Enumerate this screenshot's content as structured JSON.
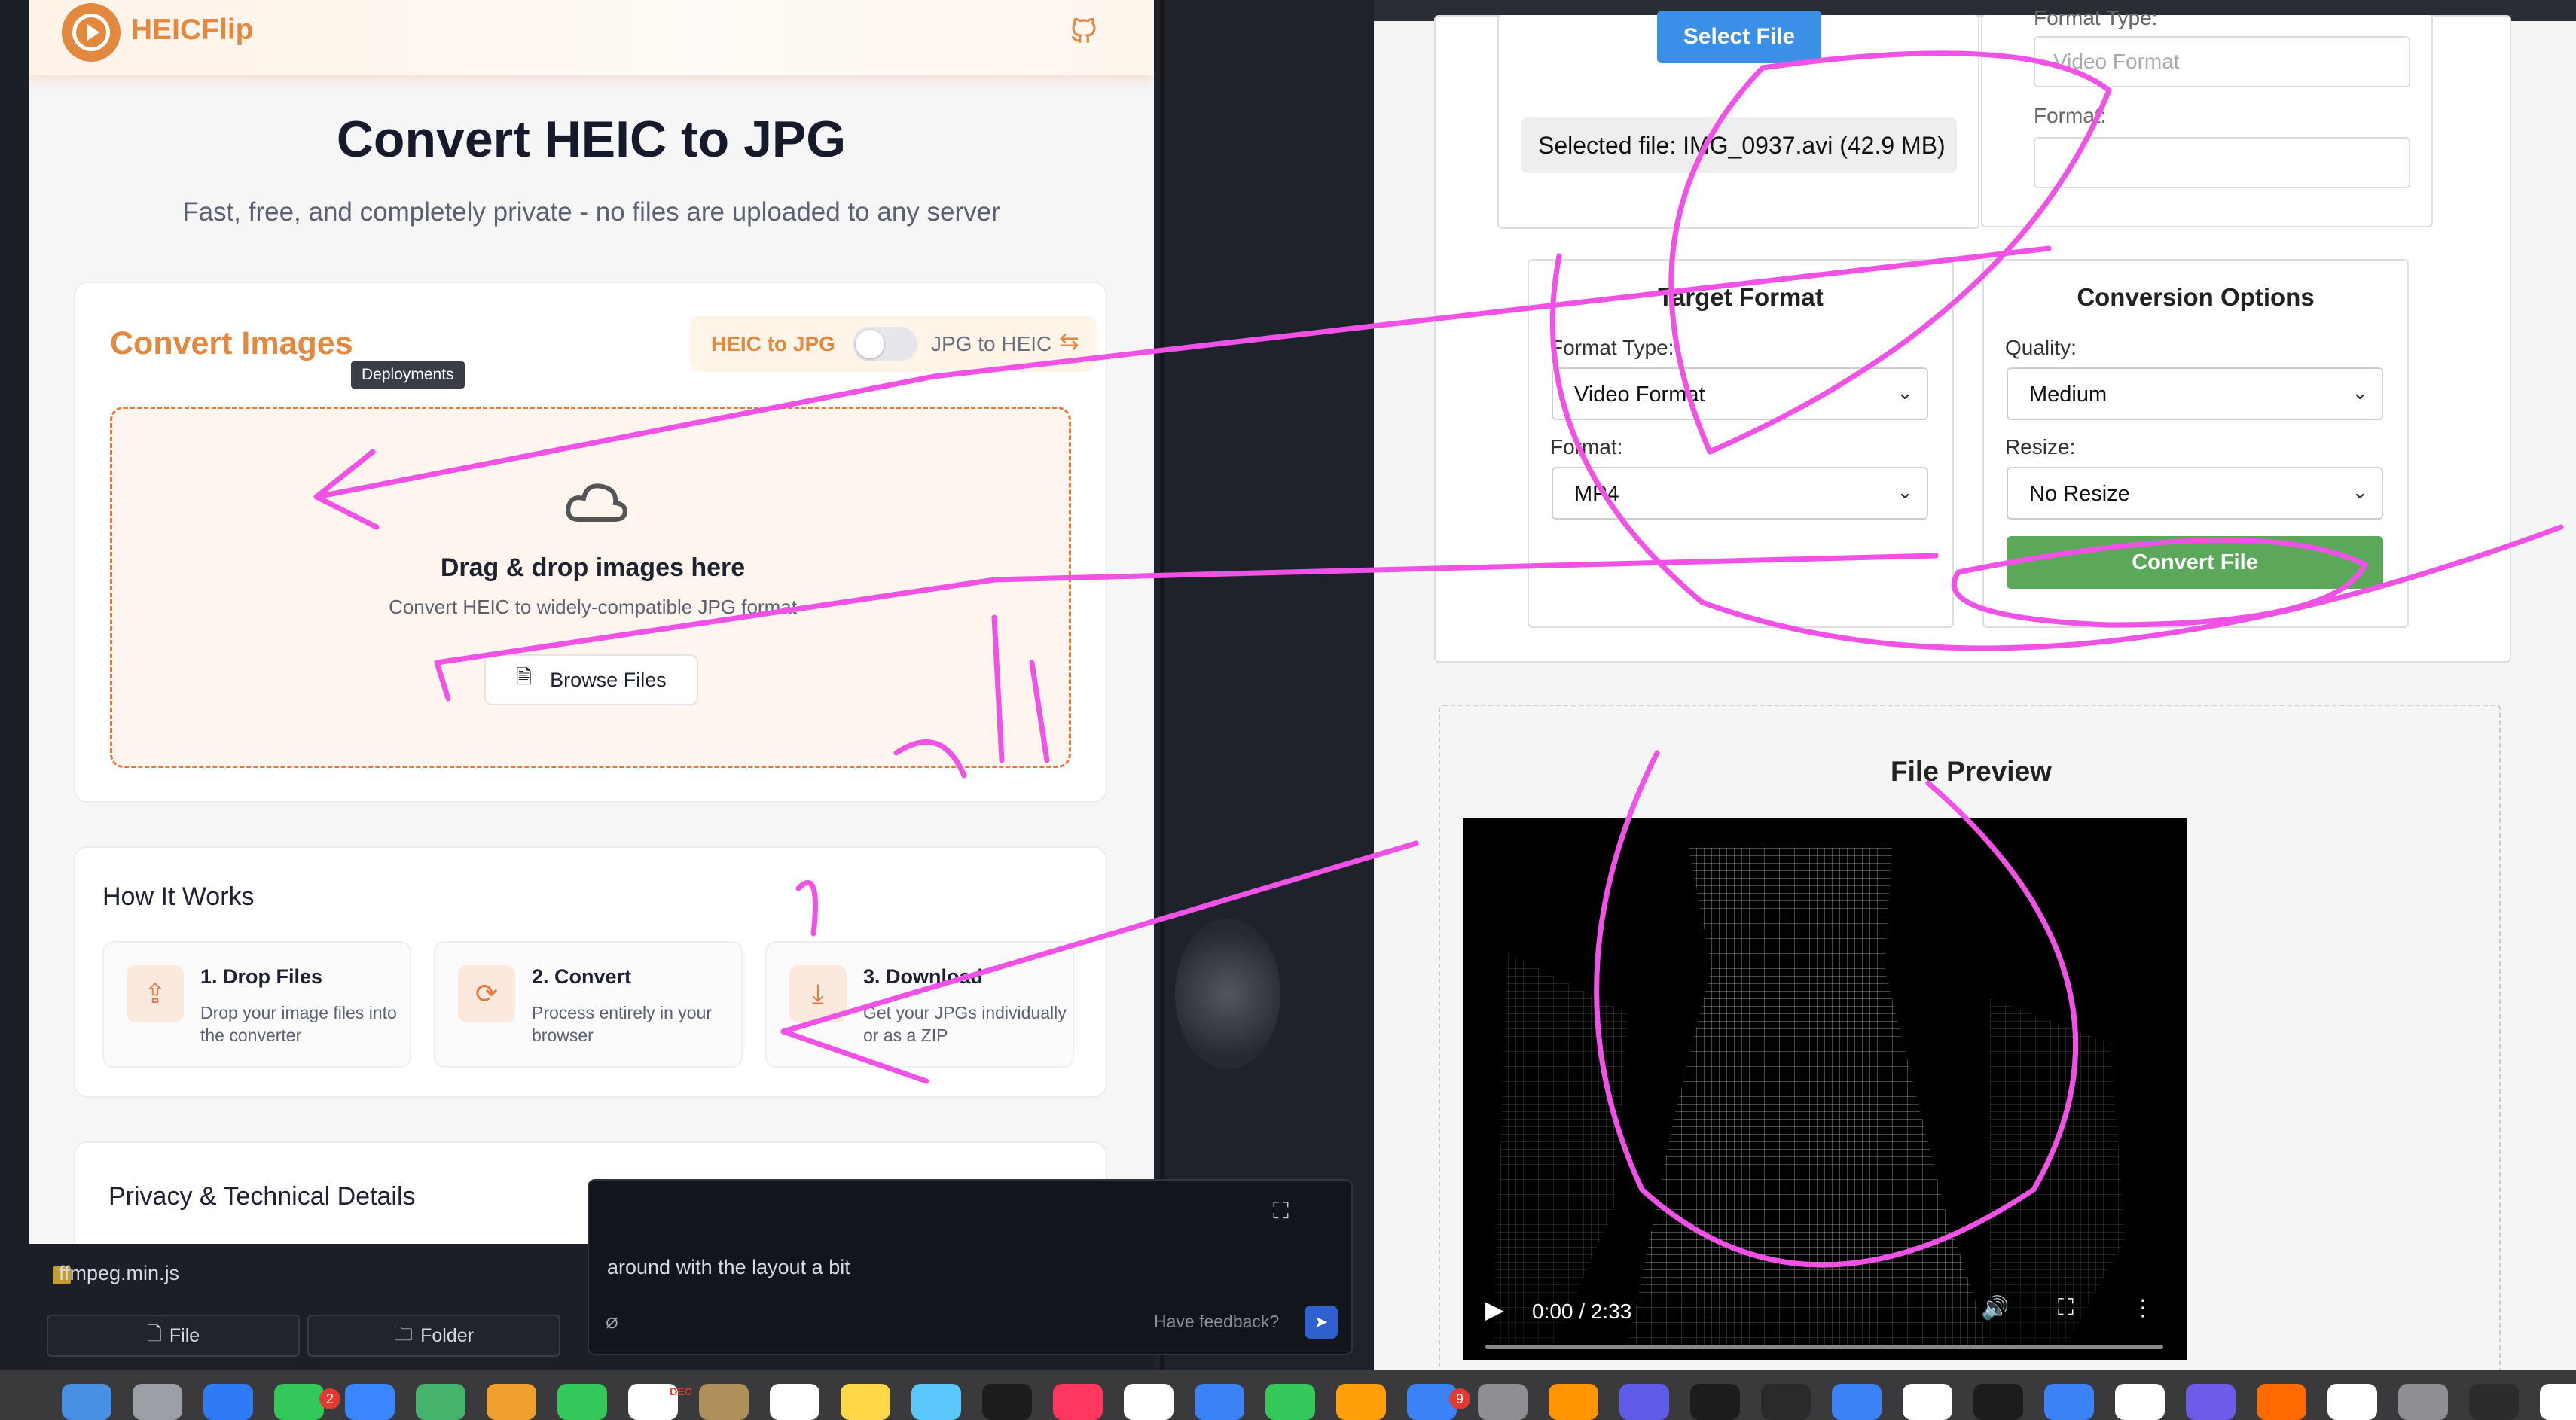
{
  "left_app": {
    "brand": "HEICFlip",
    "title": "Convert HEIC to JPG",
    "subtitle": "Fast, free, and completely private - no files are uploaded to any server",
    "convert_title": "Convert Images",
    "tooltip": "Deployments",
    "toggle_left": "HEIC to JPG",
    "toggle_right": "JPG to HEIC",
    "drop_title": "Drag & drop images here",
    "drop_sub": "Convert HEIC to widely-compatible JPG format",
    "browse_label": "Browse Files",
    "how_title": "How It Works",
    "steps": [
      {
        "title": "1. Drop Files",
        "desc": "Drop your image files into the converter"
      },
      {
        "title": "2. Convert",
        "desc": "Process entirely in your browser"
      },
      {
        "title": "3. Download",
        "desc": "Get your JPGs individually or as a ZIP"
      }
    ],
    "privacy_title": "Privacy & Technical Details"
  },
  "editor": {
    "file_name": "ffmpeg.min.js",
    "file_button": "File",
    "folder_button": "Folder",
    "chat_text": "around with the layout a bit",
    "feedback_label": "Have feedback?"
  },
  "right_app": {
    "select_button": "Select File",
    "selected_file": "Selected file: IMG_0937.avi (42.9 MB)",
    "ghost_format_type_label": "Format Type:",
    "ghost_format_type_value": "Video Format",
    "ghost_format_label": "Format:",
    "target_title": "Target Format",
    "format_type_label": "Format Type:",
    "format_type_value": "Video Format",
    "format_label": "Format:",
    "format_value": "MP4",
    "options_title": "Conversion Options",
    "quality_label": "Quality:",
    "quality_value": "Medium",
    "resize_label": "Resize:",
    "resize_value": "No Resize",
    "convert_button": "Convert File",
    "preview_title": "File Preview",
    "video_time": "0:00 / 2:33"
  },
  "dock": {
    "messages_badge": "2",
    "calendar_month": "DEC",
    "xcode_badge": "9"
  },
  "colors": {
    "accent_orange": "#e3893f",
    "convert_green": "#5ca85a",
    "select_blue": "#3b8fe6",
    "ink": "#f052e6"
  }
}
